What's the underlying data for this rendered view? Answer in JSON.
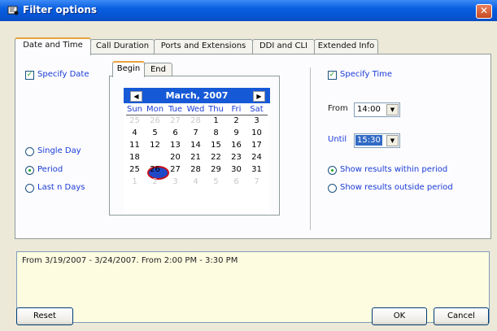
{
  "window": {
    "title": "Filter options",
    "close_glyph": "✕"
  },
  "tabs": [
    {
      "label": "Date and Time",
      "active": true
    },
    {
      "label": "Call Duration",
      "active": false
    },
    {
      "label": "Ports and Extensions",
      "active": false
    },
    {
      "label": "DDI and CLI",
      "active": false
    },
    {
      "label": "Extended Info",
      "active": false
    }
  ],
  "date": {
    "specify_date_label": "Specify Date",
    "specify_date_checked": true,
    "radios": [
      {
        "label": "Single Day",
        "checked": false
      },
      {
        "label": "Period",
        "checked": true
      },
      {
        "label": "Last n Days",
        "checked": false
      }
    ]
  },
  "calendar": {
    "subtabs": [
      {
        "label": "Begin",
        "active": true
      },
      {
        "label": "End",
        "active": false
      }
    ],
    "month": "March, 2007",
    "prev_glyph": "◀",
    "next_glyph": "▶",
    "dow": [
      "Sun",
      "Mon",
      "Tue",
      "Wed",
      "Thu",
      "Fri",
      "Sat"
    ],
    "weeks": [
      [
        "25",
        "26",
        "27",
        "28",
        "1",
        "2",
        "3"
      ],
      [
        "4",
        "5",
        "6",
        "7",
        "8",
        "9",
        "10"
      ],
      [
        "11",
        "12",
        "13",
        "14",
        "15",
        "16",
        "17"
      ],
      [
        "18",
        "19",
        "20",
        "21",
        "22",
        "23",
        "24"
      ],
      [
        "25",
        "26",
        "27",
        "28",
        "29",
        "30",
        "31"
      ],
      [
        "1",
        "2",
        "3",
        "4",
        "5",
        "6",
        "7"
      ]
    ],
    "selected_day": "19"
  },
  "time": {
    "specify_time_label": "Specify Time",
    "specify_time_checked": true,
    "from_label": "From",
    "from_value": "14:00",
    "until_label": "Until",
    "until_value": "15:30",
    "radios": [
      {
        "label": "Show results within period",
        "checked": true
      },
      {
        "label": "Show results outside period",
        "checked": false
      }
    ]
  },
  "summary": "From 3/19/2007 - 3/24/2007. From 2:00 PM - 3:30 PM",
  "buttons": {
    "reset": "Reset",
    "ok": "OK",
    "cancel": "Cancel"
  },
  "colors": {
    "title_bar": "#0a5fe0",
    "accent_blue": "#1a3bd6",
    "selection_ring": "#c8101a",
    "calendar_header": "#1659d6"
  }
}
